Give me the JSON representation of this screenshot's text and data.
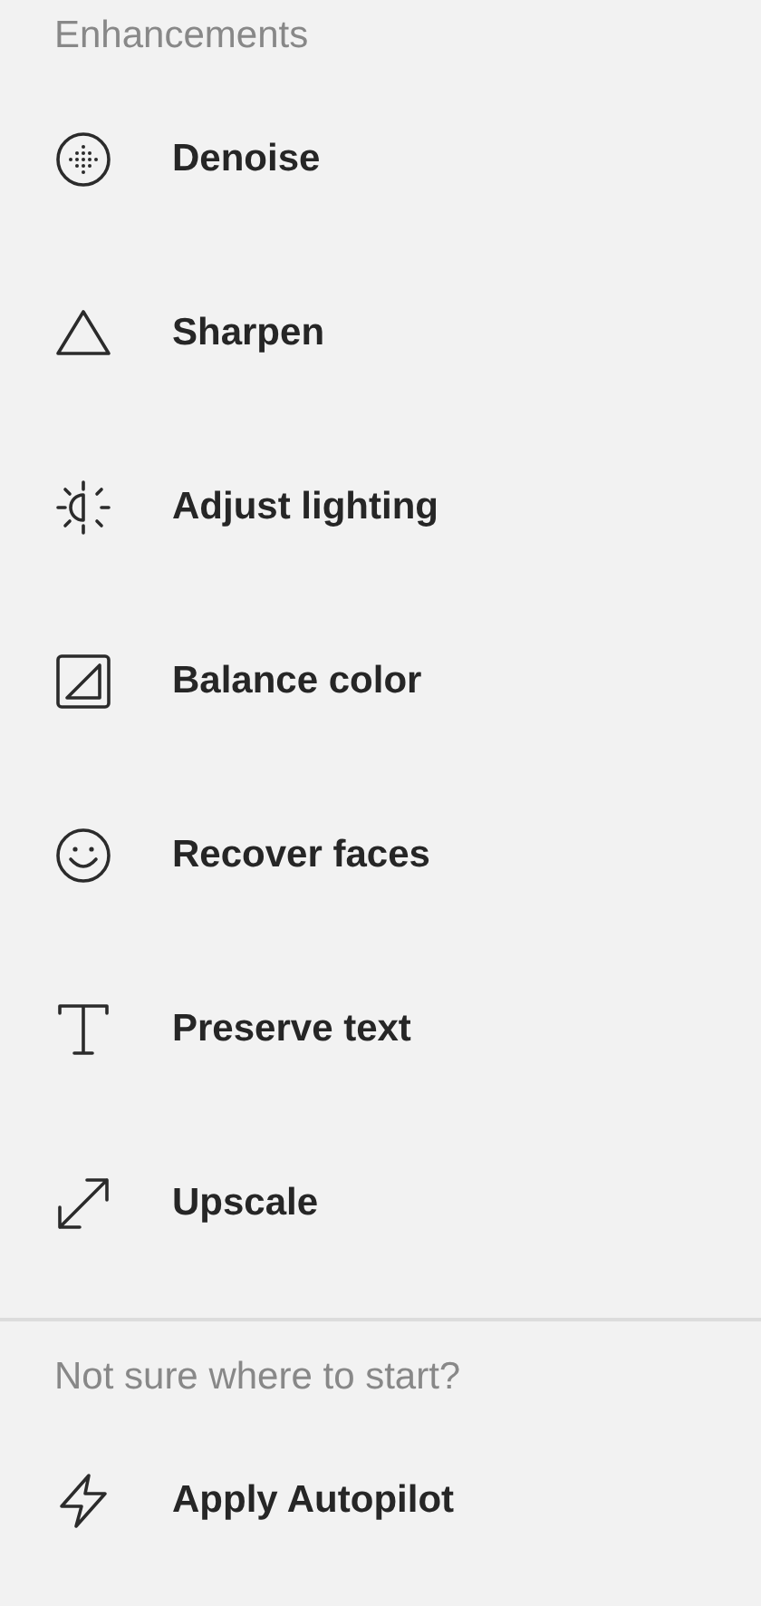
{
  "sections": [
    {
      "heading": "Enhancements",
      "items": [
        {
          "kind": "denoise",
          "label": "Denoise"
        },
        {
          "kind": "sharpen",
          "label": "Sharpen"
        },
        {
          "kind": "lighting",
          "label": "Adjust lighting"
        },
        {
          "kind": "color",
          "label": "Balance color"
        },
        {
          "kind": "faces",
          "label": "Recover faces"
        },
        {
          "kind": "text",
          "label": "Preserve text"
        },
        {
          "kind": "upscale",
          "label": "Upscale"
        }
      ]
    },
    {
      "heading": "Not sure where to start?",
      "items": [
        {
          "kind": "autopilot",
          "label": "Apply Autopilot"
        }
      ]
    }
  ]
}
